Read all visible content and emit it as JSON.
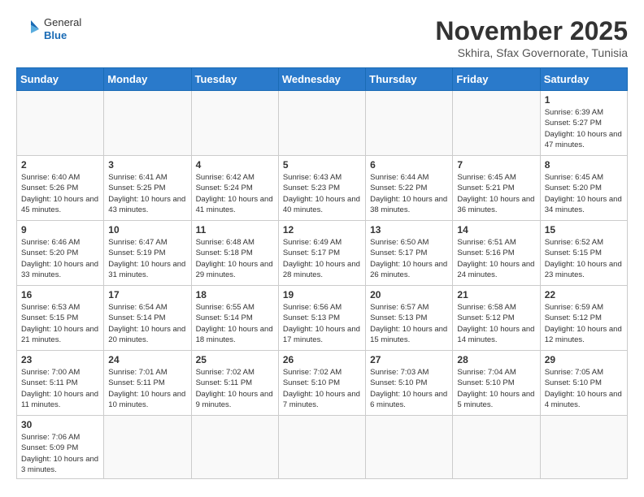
{
  "header": {
    "logo_general": "General",
    "logo_blue": "Blue",
    "month_title": "November 2025",
    "location": "Skhira, Sfax Governorate, Tunisia"
  },
  "weekdays": [
    "Sunday",
    "Monday",
    "Tuesday",
    "Wednesday",
    "Thursday",
    "Friday",
    "Saturday"
  ],
  "weeks": [
    [
      {
        "day": "",
        "info": ""
      },
      {
        "day": "",
        "info": ""
      },
      {
        "day": "",
        "info": ""
      },
      {
        "day": "",
        "info": ""
      },
      {
        "day": "",
        "info": ""
      },
      {
        "day": "",
        "info": ""
      },
      {
        "day": "1",
        "info": "Sunrise: 6:39 AM\nSunset: 5:27 PM\nDaylight: 10 hours and 47 minutes."
      }
    ],
    [
      {
        "day": "2",
        "info": "Sunrise: 6:40 AM\nSunset: 5:26 PM\nDaylight: 10 hours and 45 minutes."
      },
      {
        "day": "3",
        "info": "Sunrise: 6:41 AM\nSunset: 5:25 PM\nDaylight: 10 hours and 43 minutes."
      },
      {
        "day": "4",
        "info": "Sunrise: 6:42 AM\nSunset: 5:24 PM\nDaylight: 10 hours and 41 minutes."
      },
      {
        "day": "5",
        "info": "Sunrise: 6:43 AM\nSunset: 5:23 PM\nDaylight: 10 hours and 40 minutes."
      },
      {
        "day": "6",
        "info": "Sunrise: 6:44 AM\nSunset: 5:22 PM\nDaylight: 10 hours and 38 minutes."
      },
      {
        "day": "7",
        "info": "Sunrise: 6:45 AM\nSunset: 5:21 PM\nDaylight: 10 hours and 36 minutes."
      },
      {
        "day": "8",
        "info": "Sunrise: 6:45 AM\nSunset: 5:20 PM\nDaylight: 10 hours and 34 minutes."
      }
    ],
    [
      {
        "day": "9",
        "info": "Sunrise: 6:46 AM\nSunset: 5:20 PM\nDaylight: 10 hours and 33 minutes."
      },
      {
        "day": "10",
        "info": "Sunrise: 6:47 AM\nSunset: 5:19 PM\nDaylight: 10 hours and 31 minutes."
      },
      {
        "day": "11",
        "info": "Sunrise: 6:48 AM\nSunset: 5:18 PM\nDaylight: 10 hours and 29 minutes."
      },
      {
        "day": "12",
        "info": "Sunrise: 6:49 AM\nSunset: 5:17 PM\nDaylight: 10 hours and 28 minutes."
      },
      {
        "day": "13",
        "info": "Sunrise: 6:50 AM\nSunset: 5:17 PM\nDaylight: 10 hours and 26 minutes."
      },
      {
        "day": "14",
        "info": "Sunrise: 6:51 AM\nSunset: 5:16 PM\nDaylight: 10 hours and 24 minutes."
      },
      {
        "day": "15",
        "info": "Sunrise: 6:52 AM\nSunset: 5:15 PM\nDaylight: 10 hours and 23 minutes."
      }
    ],
    [
      {
        "day": "16",
        "info": "Sunrise: 6:53 AM\nSunset: 5:15 PM\nDaylight: 10 hours and 21 minutes."
      },
      {
        "day": "17",
        "info": "Sunrise: 6:54 AM\nSunset: 5:14 PM\nDaylight: 10 hours and 20 minutes."
      },
      {
        "day": "18",
        "info": "Sunrise: 6:55 AM\nSunset: 5:14 PM\nDaylight: 10 hours and 18 minutes."
      },
      {
        "day": "19",
        "info": "Sunrise: 6:56 AM\nSunset: 5:13 PM\nDaylight: 10 hours and 17 minutes."
      },
      {
        "day": "20",
        "info": "Sunrise: 6:57 AM\nSunset: 5:13 PM\nDaylight: 10 hours and 15 minutes."
      },
      {
        "day": "21",
        "info": "Sunrise: 6:58 AM\nSunset: 5:12 PM\nDaylight: 10 hours and 14 minutes."
      },
      {
        "day": "22",
        "info": "Sunrise: 6:59 AM\nSunset: 5:12 PM\nDaylight: 10 hours and 12 minutes."
      }
    ],
    [
      {
        "day": "23",
        "info": "Sunrise: 7:00 AM\nSunset: 5:11 PM\nDaylight: 10 hours and 11 minutes."
      },
      {
        "day": "24",
        "info": "Sunrise: 7:01 AM\nSunset: 5:11 PM\nDaylight: 10 hours and 10 minutes."
      },
      {
        "day": "25",
        "info": "Sunrise: 7:02 AM\nSunset: 5:11 PM\nDaylight: 10 hours and 9 minutes."
      },
      {
        "day": "26",
        "info": "Sunrise: 7:02 AM\nSunset: 5:10 PM\nDaylight: 10 hours and 7 minutes."
      },
      {
        "day": "27",
        "info": "Sunrise: 7:03 AM\nSunset: 5:10 PM\nDaylight: 10 hours and 6 minutes."
      },
      {
        "day": "28",
        "info": "Sunrise: 7:04 AM\nSunset: 5:10 PM\nDaylight: 10 hours and 5 minutes."
      },
      {
        "day": "29",
        "info": "Sunrise: 7:05 AM\nSunset: 5:10 PM\nDaylight: 10 hours and 4 minutes."
      }
    ],
    [
      {
        "day": "30",
        "info": "Sunrise: 7:06 AM\nSunset: 5:09 PM\nDaylight: 10 hours and 3 minutes."
      },
      {
        "day": "",
        "info": ""
      },
      {
        "day": "",
        "info": ""
      },
      {
        "day": "",
        "info": ""
      },
      {
        "day": "",
        "info": ""
      },
      {
        "day": "",
        "info": ""
      },
      {
        "day": "",
        "info": ""
      }
    ]
  ]
}
